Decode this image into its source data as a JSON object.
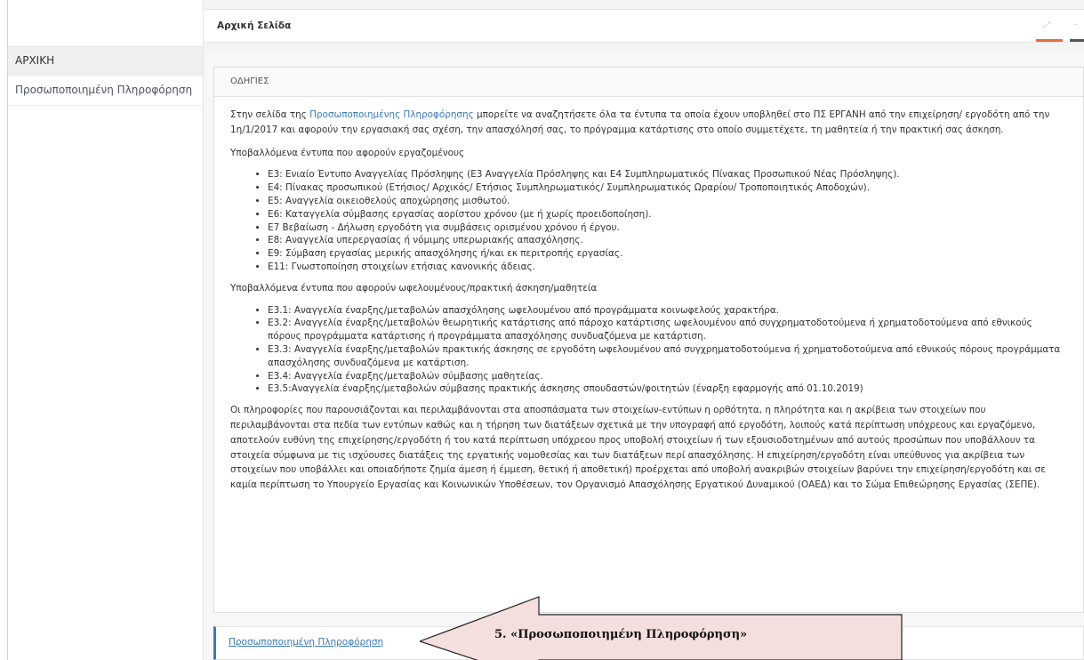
{
  "sidebar": {
    "items": [
      {
        "label": "ΑΡΧΙΚΗ"
      },
      {
        "label": "Προσωποποιημένη Πληροφόρηση"
      }
    ]
  },
  "header": {
    "title": "Αρχική Σελίδα"
  },
  "panel": {
    "title": "ΟΔΗΓΙΕΣ",
    "intro_before": "Στην σελίδα της ",
    "intro_link": "Προσωποποιημένης Πληροφόρησης",
    "intro_after": " μπορείτε να αναζητήσετε όλα τα έντυπα τα οποία έχουν υποβληθεί στο ΠΣ ΕΡΓΑΝΗ από την επιχείρηση/ εργοδότη από την 1η/1/2017 και αφορούν την εργασιακή σας σχέση, την απασχόλησή σας, το πρόγραμμα κατάρτισης στο οποίο συμμετέχετε, τη μαθητεία ή την πρακτική σας άσκηση.",
    "employees_heading": "Υποβαλλόμενα έντυπα που αφορούν εργαζομένους",
    "employees_items": [
      "Ε3: Ενιαίο Έντυπο Αναγγελίας Πρόσληψης (Ε3 Αναγγελία Πρόσληψης και Ε4 Συμπληρωματικός Πίνακας Προσωπικού Νέας Πρόσληψης).",
      "Ε4: Πίνακας προσωπικού (Ετήσιος/ Αρχικός/ Ετήσιος Συμπληρωματικός/ Συμπληρωματικός Ωραρίου/ Τροποποιητικός Αποδοχών).",
      "Ε5: Αναγγελία οικειοθελούς αποχώρησης μισθωτού.",
      "Ε6: Καταγγελία σύμβασης εργασίας αορίστου χρόνου (με ή χωρίς προειδοποίηση).",
      "Ε7 Βεβαίωση - Δήλωση εργοδότη για συμβάσεις ορισμένου χρόνου ή έργου.",
      "Ε8: Αναγγελία υπερεργασίας ή νόμιμης υπερωριακής απασχόλησης.",
      "Ε9: Σύμβαση εργασίας μερικής απασχόλησης ή/και εκ περιτροπής εργασίας.",
      "Ε11: Γνωστοποίηση στοιχείων ετήσιας κανονικής άδειας."
    ],
    "beneficiaries_heading": "Υποβαλλόμενα έντυπα που αφορούν ωφελουμένους/πρακτική άσκηση/μαθητεία",
    "beneficiaries_items": [
      "Ε3.1: Αναγγελία έναρξης/μεταβολών απασχόλησης ωφελουμένου από προγράμματα κοινωφελούς χαρακτήρα.",
      "Ε3.2: Αναγγελία έναρξης/μεταβολών θεωρητικής κατάρτισης από πάροχο κατάρτισης ωφελουμένου από συγχρηματοδοτούμενα ή χρηματοδοτούμενα από εθνικούς πόρους προγράμματα κατάρτισης ή προγράμματα απασχόλησης συνδυαζόμενα με κατάρτιση.",
      "Ε3.3: Αναγγελία έναρξης/μεταβολών πρακτικής άσκησης σε εργοδότη ωφελουμένου από συγχρηματοδοτούμενα ή χρηματοδοτούμενα από εθνικούς πόρους προγράμματα απασχόλησης συνδυαζόμενα με κατάρτιση.",
      "Ε3.4: Αναγγελία έναρξης/μεταβολών σύμβασης μαθητείας.",
      "Ε3.5:Αναγγελία έναρξης/μεταβολών σύμβασης πρακτικής άσκησης σπουδαστών/φοιτητών (έναρξη εφαρμογής από 01.10.2019)"
    ],
    "disclaimer": "Οι πληροφορίες που παρουσιάζονται και περιλαμβάνονται στα αποσπάσματα των στοιχείων-εντύπων η ορθότητα, η πληρότητα και η ακρίβεια των στοιχείων που περιλαμβάνονται στα πεδία των εντύπων καθώς και η τήρηση των διατάξεων σχετικά με την υπογραφή από εργοδότη, λοιπούς κατά περίπτωση υπόχρεους και εργαζόμενο, αποτελούν ευθύνη της επιχείρησης/εργοδότη ή του κατά περίπτωση υπόχρεου προς υποβολή στοιχείων ή των εξουσιοδοτημένων από αυτούς προσώπων που υποβάλλουν τα στοιχεία σύμφωνα με τις ισχύουσες διατάξεις της εργατικής νομοθεσίας και των διατάξεων περί απασχόλησης. Η επιχείρηση/εργοδότη είναι υπεύθυνος για ακρίβεια των στοιχείων που υποβάλλει και οποιαδήποτε ζημία άμεση ή έμμεση, θετική ή αποθετική) προέρχεται από υποβολή ανακριβών στοιχείων βαρύνει την επιχείρηση/εργοδότη και σε καμία περίπτωση το Υπουργείο Εργασίας και Κοινωνικών Υποθέσεων, τον Οργανισμό Απασχόλησης Εργατικού Δυναμικού (ΟΑΕΔ) και το Σώμα Επιθεώρησης Εργασίας (ΣΕΠΕ)."
  },
  "bottom_link": {
    "label": "Προσωποποιημένη Πληροφόρηση"
  },
  "callout": {
    "text": "5. «Προσωποποιημένη  Πληροφόρηση»"
  }
}
